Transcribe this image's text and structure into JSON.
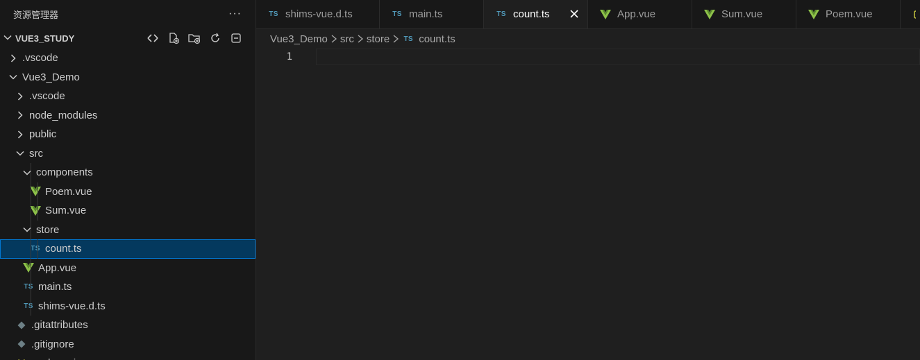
{
  "sidebar": {
    "title": "资源管理器",
    "more_label": "···",
    "section": {
      "title": "VUE3_STUDY"
    },
    "actions": [
      {
        "name": "new-file-icon"
      },
      {
        "name": "new-folder-icon"
      },
      {
        "name": "refresh-icon"
      },
      {
        "name": "collapse-all-icon"
      }
    ],
    "tree": [
      {
        "label": ".vscode",
        "depth": 0,
        "type": "folder",
        "expanded": false
      },
      {
        "label": "Vue3_Demo",
        "depth": 0,
        "type": "folder",
        "expanded": true
      },
      {
        "label": ".vscode",
        "depth": 1,
        "type": "folder",
        "expanded": false
      },
      {
        "label": "node_modules",
        "depth": 1,
        "type": "folder",
        "expanded": false
      },
      {
        "label": "public",
        "depth": 1,
        "type": "folder",
        "expanded": false
      },
      {
        "label": "src",
        "depth": 1,
        "type": "folder",
        "expanded": true
      },
      {
        "label": "components",
        "depth": 2,
        "type": "folder",
        "expanded": true
      },
      {
        "label": "Poem.vue",
        "depth": 3,
        "type": "vue"
      },
      {
        "label": "Sum.vue",
        "depth": 3,
        "type": "vue"
      },
      {
        "label": "store",
        "depth": 2,
        "type": "folder",
        "expanded": true
      },
      {
        "label": "count.ts",
        "depth": 3,
        "type": "ts",
        "selected": true
      },
      {
        "label": "App.vue",
        "depth": 2,
        "type": "vue"
      },
      {
        "label": "main.ts",
        "depth": 2,
        "type": "ts"
      },
      {
        "label": "shims-vue.d.ts",
        "depth": 2,
        "type": "ts"
      },
      {
        "label": ".gitattributes",
        "depth": 1,
        "type": "git"
      },
      {
        "label": ".gitignore",
        "depth": 1,
        "type": "git"
      },
      {
        "label": "package.json",
        "depth": 1,
        "type": "json"
      }
    ]
  },
  "tabs": [
    {
      "label": "shims-vue.d.ts",
      "type": "ts"
    },
    {
      "label": "main.ts",
      "type": "ts"
    },
    {
      "label": "count.ts",
      "type": "ts",
      "active": true
    },
    {
      "label": "App.vue",
      "type": "vue"
    },
    {
      "label": "Sum.vue",
      "type": "vue"
    },
    {
      "label": "Poem.vue",
      "type": "vue"
    },
    {
      "label": "",
      "type": "json"
    }
  ],
  "breadcrumb": [
    "Vue3_Demo",
    "src",
    "store",
    "count.ts"
  ],
  "editor": {
    "line_number": "1"
  },
  "colors": {
    "ts": "#519aba",
    "vue": "#8dc149",
    "selected_bg": "#04395e",
    "focus": "#0078d4"
  },
  "icons": {
    "ts_badge": "TS"
  }
}
